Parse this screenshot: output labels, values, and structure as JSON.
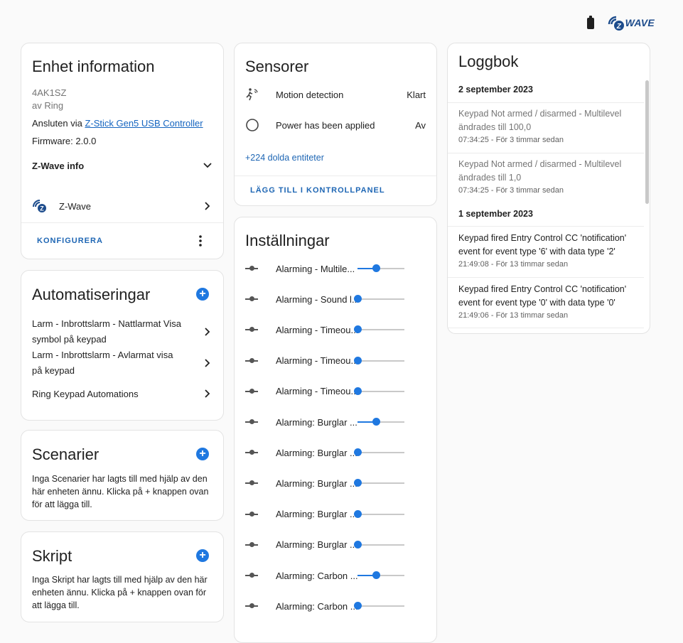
{
  "device": {
    "title": "Enhet information",
    "model": "4AK1SZ",
    "manufacturer": "av Ring",
    "connected_prefix": "Ansluten via ",
    "connected_link": "Z-Stick Gen5 USB Controller",
    "firmware": "Firmware: 2.0.0",
    "zwave_info_label": "Z-Wave info",
    "integration_label": "Z-Wave",
    "configure_label": "KONFIGURERA"
  },
  "automations": {
    "title": "Automatiseringar",
    "items": [
      "Larm - Inbrottslarm - Nattlarmat Visa symbol på keypad",
      "Larm - Inbrottslarm - Avlarmat visa på keypad",
      "Ring Keypad Automations"
    ]
  },
  "scenes": {
    "title": "Scenarier",
    "empty_text": "Inga Scenarier har lagts till med hjälp av den här enheten ännu. Klicka på + knappen ovan för att lägga till."
  },
  "scripts": {
    "title": "Skript",
    "empty_text": "Inga Skript har lagts till med hjälp av den här enheten ännu. Klicka på + knappen ovan för att lägga till."
  },
  "sensors": {
    "title": "Sensorer",
    "items": [
      {
        "name": "Motion detection",
        "state": "Klart",
        "icon": "motion-sensor-icon"
      },
      {
        "name": "Power has been applied",
        "state": "Av",
        "icon": "circle-outline-icon"
      }
    ],
    "hidden_entities": "+224 dolda entiteter",
    "add_to_dashboard": "LÄGG TILL I KONTROLLPANEL"
  },
  "settings": {
    "title": "Inställningar",
    "items": [
      {
        "name": "Alarming - Multile...",
        "value": 0.4
      },
      {
        "name": "Alarming - Sound l...",
        "value": 0.0
      },
      {
        "name": "Alarming - Timeou...",
        "value": 0.0
      },
      {
        "name": "Alarming - Timeou...",
        "value": 0.0
      },
      {
        "name": "Alarming - Timeou...",
        "value": 0.0
      },
      {
        "name": "Alarming: Burglar ...",
        "value": 0.4
      },
      {
        "name": "Alarming: Burglar ...",
        "value": 0.0
      },
      {
        "name": "Alarming: Burglar ...",
        "value": 0.0
      },
      {
        "name": "Alarming: Burglar ...",
        "value": 0.0
      },
      {
        "name": "Alarming: Burglar ...",
        "value": 0.0
      },
      {
        "name": "Alarming: Carbon ...",
        "value": 0.4
      },
      {
        "name": "Alarming: Carbon ...",
        "value": 0.0
      }
    ]
  },
  "logbook": {
    "title": "Loggbok",
    "days": [
      {
        "date": "2 september 2023",
        "entries": [
          {
            "text": "Keypad Not armed / disarmed - Multilevel ändrades till 100,0",
            "time": "07:34:25 - För 3 timmar sedan",
            "muted": true
          },
          {
            "text": "Keypad Not armed / disarmed - Multilevel ändrades till 1,0",
            "time": "07:34:25 - För 3 timmar sedan",
            "muted": true
          }
        ]
      },
      {
        "date": "1 september 2023",
        "entries": [
          {
            "text": "Keypad fired Entry Control CC 'notification' event for event type '6' with data type '2'",
            "time": "21:49:08 - För 13 timmar sedan",
            "muted": false
          },
          {
            "text": "Keypad fired Entry Control CC 'notification' event for event type '0' with data type '0'",
            "time": "21:49:06 - För 13 timmar sedan",
            "muted": false
          }
        ]
      }
    ]
  },
  "header": {
    "zwave_logo_text": "WAVE"
  },
  "colors": {
    "accent": "#1f78e0",
    "link": "#1565c0",
    "button_text": "#1e66b4"
  }
}
